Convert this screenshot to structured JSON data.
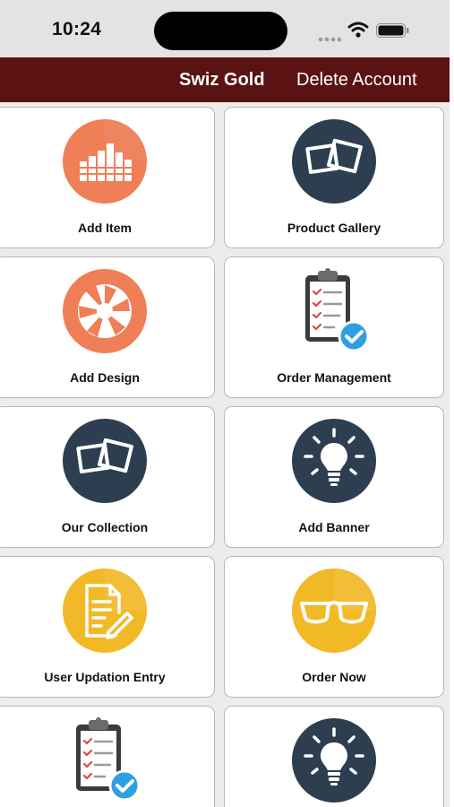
{
  "status_bar": {
    "time": "10:24"
  },
  "nav": {
    "brand": "Swiz Gold",
    "delete_label": "Delete Account"
  },
  "grid": {
    "cards": [
      {
        "label": "Add Item",
        "icon": "equalizer-icon"
      },
      {
        "label": "Product Gallery",
        "icon": "photos-icon"
      },
      {
        "label": "Add Design",
        "icon": "aperture-icon"
      },
      {
        "label": "Order Management",
        "icon": "checklist-icon"
      },
      {
        "label": "Our Collection",
        "icon": "photos-icon"
      },
      {
        "label": "Add Banner",
        "icon": "lightbulb-icon"
      },
      {
        "label": "User Updation Entry",
        "icon": "document-edit-icon"
      },
      {
        "label": "Order Now",
        "icon": "glasses-icon"
      },
      {
        "label": "",
        "icon": "checklist-icon"
      },
      {
        "label": "",
        "icon": "lightbulb-icon"
      }
    ]
  },
  "colors": {
    "nav_background": "#5b1213",
    "orange": "#ee7f56",
    "navy": "#2d3e50",
    "yellow": "#f2b927",
    "check_blue": "#2f9fe3"
  }
}
